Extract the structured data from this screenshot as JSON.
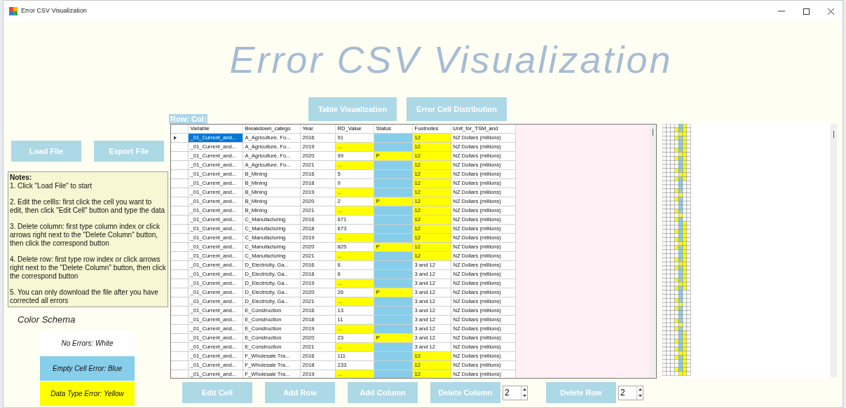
{
  "window": {
    "title": "Error CSV Visualization"
  },
  "heading": "Error CSV Visualization",
  "view_buttons": [
    "Table Visualization",
    "Error Cell Distribution"
  ],
  "position_label": "Row: Col:",
  "file_buttons": [
    "Load File",
    "Export File"
  ],
  "notes": {
    "title": "Notes:",
    "items": [
      "1. Click \"Load File\" to start",
      "2. Edit the cellls: first click the cell you want to edit, then click \"Edit Cell\" button and type the data",
      "3. Delete column: first type column index or click arrows right next to the \"Delete Column\" button,  then click the correspond button",
      "4. Delete row: first type row index or click arrows right next to the \"Delete Column\" button, then click the correspond button",
      "5. You can only download the file after you have corrected all errors"
    ]
  },
  "color_schema": {
    "title": "Color Schema",
    "entries": [
      {
        "label": "No Errors: White",
        "color": "#ffffff"
      },
      {
        "label": "Empty Cell Error: Blue",
        "color": "#87ceeb"
      },
      {
        "label": "Data Type Error: Yellow",
        "color": "#ffff00"
      }
    ]
  },
  "table": {
    "columns": [
      "Variable",
      "Breakdown_catego",
      "Year",
      "RD_Value",
      "Status",
      "Footnotes",
      "Unit_for_TSM_and"
    ],
    "rows": [
      {
        "current": true,
        "cells": [
          {
            "text": "_01_Current_and...",
            "empty_error": false,
            "type_error": false,
            "selected": true
          },
          {
            "text": "A_Agriculture, Fo...",
            "empty_error": false,
            "type_error": false,
            "selected": false
          },
          {
            "text": "2016",
            "empty_error": false,
            "type_error": false,
            "selected": false
          },
          {
            "text": "91",
            "empty_error": false,
            "type_error": false,
            "selected": false
          },
          {
            "empty_error": true,
            "type_error": false,
            "selected": false
          },
          {
            "text": "12",
            "empty_error": false,
            "type_error": true,
            "selected": false
          },
          {
            "text": "NZ Dollars (millions)",
            "empty_error": false,
            "type_error": false,
            "selected": false
          }
        ]
      },
      {
        "current": false,
        "cells": [
          {
            "text": "_01_Current_and...",
            "empty_error": false,
            "type_error": false,
            "selected": false
          },
          {
            "text": "A_Agriculture, Fo...",
            "empty_error": false,
            "type_error": false,
            "selected": false
          },
          {
            "text": "2019",
            "empty_error": false,
            "type_error": false,
            "selected": false
          },
          {
            "text": "...",
            "empty_error": false,
            "type_error": true,
            "selected": false
          },
          {
            "empty_error": true,
            "type_error": false,
            "selected": false
          },
          {
            "text": "12",
            "empty_error": false,
            "type_error": true,
            "selected": false
          },
          {
            "text": "NZ Dollars (millions)",
            "empty_error": false,
            "type_error": false,
            "selected": false
          }
        ]
      },
      {
        "current": false,
        "cells": [
          {
            "text": "_01_Current_and...",
            "empty_error": false,
            "type_error": false,
            "selected": false
          },
          {
            "text": "A_Agriculture, Fo...",
            "empty_error": false,
            "type_error": false,
            "selected": false
          },
          {
            "text": "2020",
            "empty_error": false,
            "type_error": false,
            "selected": false
          },
          {
            "text": "99",
            "empty_error": false,
            "type_error": false,
            "selected": false
          },
          {
            "text": "P",
            "empty_error": false,
            "type_error": true,
            "selected": false
          },
          {
            "text": "12",
            "empty_error": false,
            "type_error": true,
            "selected": false
          },
          {
            "text": "NZ Dollars (millions)",
            "empty_error": false,
            "type_error": false,
            "selected": false
          }
        ]
      },
      {
        "current": false,
        "cells": [
          {
            "text": "_01_Current_and...",
            "empty_error": false,
            "type_error": false,
            "selected": false
          },
          {
            "text": "A_Agriculture, Fo...",
            "empty_error": false,
            "type_error": false,
            "selected": false
          },
          {
            "text": "2021",
            "empty_error": false,
            "type_error": false,
            "selected": false
          },
          {
            "text": "...",
            "empty_error": false,
            "type_error": true,
            "selected": false
          },
          {
            "empty_error": true,
            "type_error": false,
            "selected": false
          },
          {
            "text": "12",
            "empty_error": false,
            "type_error": true,
            "selected": false
          },
          {
            "text": "NZ Dollars (millions)",
            "empty_error": false,
            "type_error": false,
            "selected": false
          }
        ]
      },
      {
        "current": false,
        "cells": [
          {
            "text": "_01_Current_and...",
            "empty_error": false,
            "type_error": false,
            "selected": false
          },
          {
            "text": "B_Mining",
            "empty_error": false,
            "type_error": false,
            "selected": false
          },
          {
            "text": "2016",
            "empty_error": false,
            "type_error": false,
            "selected": false
          },
          {
            "text": "5",
            "empty_error": false,
            "type_error": false,
            "selected": false
          },
          {
            "empty_error": true,
            "type_error": false,
            "selected": false
          },
          {
            "text": "12",
            "empty_error": false,
            "type_error": true,
            "selected": false
          },
          {
            "text": "NZ Dollars (millions)",
            "empty_error": false,
            "type_error": false,
            "selected": false
          }
        ]
      },
      {
        "current": false,
        "cells": [
          {
            "text": "_01_Current_and...",
            "empty_error": false,
            "type_error": false,
            "selected": false
          },
          {
            "text": "B_Mining",
            "empty_error": false,
            "type_error": false,
            "selected": false
          },
          {
            "text": "2018",
            "empty_error": false,
            "type_error": false,
            "selected": false
          },
          {
            "text": "9",
            "empty_error": false,
            "type_error": false,
            "selected": false
          },
          {
            "empty_error": true,
            "type_error": false,
            "selected": false
          },
          {
            "text": "12",
            "empty_error": false,
            "type_error": true,
            "selected": false
          },
          {
            "text": "NZ Dollars (millions)",
            "empty_error": false,
            "type_error": false,
            "selected": false
          }
        ]
      },
      {
        "current": false,
        "cells": [
          {
            "text": "_01_Current_and...",
            "empty_error": false,
            "type_error": false,
            "selected": false
          },
          {
            "text": "B_Mining",
            "empty_error": false,
            "type_error": false,
            "selected": false
          },
          {
            "text": "2019",
            "empty_error": false,
            "type_error": false,
            "selected": false
          },
          {
            "text": "...",
            "empty_error": false,
            "type_error": true,
            "selected": false
          },
          {
            "empty_error": true,
            "type_error": false,
            "selected": false
          },
          {
            "text": "12",
            "empty_error": false,
            "type_error": true,
            "selected": false
          },
          {
            "text": "NZ Dollars (millions)",
            "empty_error": false,
            "type_error": false,
            "selected": false
          }
        ]
      },
      {
        "current": false,
        "cells": [
          {
            "text": "_01_Current_and...",
            "empty_error": false,
            "type_error": false,
            "selected": false
          },
          {
            "text": "B_Mining",
            "empty_error": false,
            "type_error": false,
            "selected": false
          },
          {
            "text": "2020",
            "empty_error": false,
            "type_error": false,
            "selected": false
          },
          {
            "text": "2",
            "empty_error": false,
            "type_error": false,
            "selected": false
          },
          {
            "text": "P",
            "empty_error": false,
            "type_error": true,
            "selected": false
          },
          {
            "text": "12",
            "empty_error": false,
            "type_error": true,
            "selected": false
          },
          {
            "text": "NZ Dollars (millions)",
            "empty_error": false,
            "type_error": false,
            "selected": false
          }
        ]
      },
      {
        "current": false,
        "cells": [
          {
            "text": "_01_Current_and...",
            "empty_error": false,
            "type_error": false,
            "selected": false
          },
          {
            "text": "B_Mining",
            "empty_error": false,
            "type_error": false,
            "selected": false
          },
          {
            "text": "2021",
            "empty_error": false,
            "type_error": false,
            "selected": false
          },
          {
            "text": "...",
            "empty_error": false,
            "type_error": true,
            "selected": false
          },
          {
            "empty_error": true,
            "type_error": false,
            "selected": false
          },
          {
            "text": "12",
            "empty_error": false,
            "type_error": true,
            "selected": false
          },
          {
            "text": "NZ Dollars (millions)",
            "empty_error": false,
            "type_error": false,
            "selected": false
          }
        ]
      },
      {
        "current": false,
        "cells": [
          {
            "text": "_01_Current_and...",
            "empty_error": false,
            "type_error": false,
            "selected": false
          },
          {
            "text": "C_Manufacturing",
            "empty_error": false,
            "type_error": false,
            "selected": false
          },
          {
            "text": "2016",
            "empty_error": false,
            "type_error": false,
            "selected": false
          },
          {
            "text": "671",
            "empty_error": false,
            "type_error": false,
            "selected": false
          },
          {
            "empty_error": true,
            "type_error": false,
            "selected": false
          },
          {
            "text": "12",
            "empty_error": false,
            "type_error": true,
            "selected": false
          },
          {
            "text": "NZ Dollars (millions)",
            "empty_error": false,
            "type_error": false,
            "selected": false
          }
        ]
      },
      {
        "current": false,
        "cells": [
          {
            "text": "_01_Current_and...",
            "empty_error": false,
            "type_error": false,
            "selected": false
          },
          {
            "text": "C_Manufacturing",
            "empty_error": false,
            "type_error": false,
            "selected": false
          },
          {
            "text": "2018",
            "empty_error": false,
            "type_error": false,
            "selected": false
          },
          {
            "text": "673",
            "empty_error": false,
            "type_error": false,
            "selected": false
          },
          {
            "empty_error": true,
            "type_error": false,
            "selected": false
          },
          {
            "text": "12",
            "empty_error": false,
            "type_error": true,
            "selected": false
          },
          {
            "text": "NZ Dollars (millions)",
            "empty_error": false,
            "type_error": false,
            "selected": false
          }
        ]
      },
      {
        "current": false,
        "cells": [
          {
            "text": "_01_Current_and...",
            "empty_error": false,
            "type_error": false,
            "selected": false
          },
          {
            "text": "C_Manufacturing",
            "empty_error": false,
            "type_error": false,
            "selected": false
          },
          {
            "text": "2019",
            "empty_error": false,
            "type_error": false,
            "selected": false
          },
          {
            "text": "...",
            "empty_error": false,
            "type_error": true,
            "selected": false
          },
          {
            "empty_error": true,
            "type_error": false,
            "selected": false
          },
          {
            "text": "12",
            "empty_error": false,
            "type_error": true,
            "selected": false
          },
          {
            "text": "NZ Dollars (millions)",
            "empty_error": false,
            "type_error": false,
            "selected": false
          }
        ]
      },
      {
        "current": false,
        "cells": [
          {
            "text": "_01_Current_and...",
            "empty_error": false,
            "type_error": false,
            "selected": false
          },
          {
            "text": "C_Manufacturing",
            "empty_error": false,
            "type_error": false,
            "selected": false
          },
          {
            "text": "2020",
            "empty_error": false,
            "type_error": false,
            "selected": false
          },
          {
            "text": "825",
            "empty_error": false,
            "type_error": false,
            "selected": false
          },
          {
            "text": "P",
            "empty_error": false,
            "type_error": true,
            "selected": false
          },
          {
            "text": "12",
            "empty_error": false,
            "type_error": true,
            "selected": false
          },
          {
            "text": "NZ Dollars (millions)",
            "empty_error": false,
            "type_error": false,
            "selected": false
          }
        ]
      },
      {
        "current": false,
        "cells": [
          {
            "text": "_01_Current_and...",
            "empty_error": false,
            "type_error": false,
            "selected": false
          },
          {
            "text": "C_Manufacturing",
            "empty_error": false,
            "type_error": false,
            "selected": false
          },
          {
            "text": "2021",
            "empty_error": false,
            "type_error": false,
            "selected": false
          },
          {
            "text": "...",
            "empty_error": false,
            "type_error": true,
            "selected": false
          },
          {
            "empty_error": true,
            "type_error": false,
            "selected": false
          },
          {
            "text": "12",
            "empty_error": false,
            "type_error": true,
            "selected": false
          },
          {
            "text": "NZ Dollars (millions)",
            "empty_error": false,
            "type_error": false,
            "selected": false
          }
        ]
      },
      {
        "current": false,
        "cells": [
          {
            "text": "_01_Current_and...",
            "empty_error": false,
            "type_error": false,
            "selected": false
          },
          {
            "text": "D_Electricity, Ga...",
            "empty_error": false,
            "type_error": false,
            "selected": false
          },
          {
            "text": "2016",
            "empty_error": false,
            "type_error": false,
            "selected": false
          },
          {
            "text": "6",
            "empty_error": false,
            "type_error": false,
            "selected": false
          },
          {
            "empty_error": true,
            "type_error": false,
            "selected": false
          },
          {
            "text": "3 and 12",
            "empty_error": false,
            "type_error": false,
            "selected": false
          },
          {
            "text": "NZ Dollars (millions)",
            "empty_error": false,
            "type_error": false,
            "selected": false
          }
        ]
      },
      {
        "current": false,
        "cells": [
          {
            "text": "_01_Current_and...",
            "empty_error": false,
            "type_error": false,
            "selected": false
          },
          {
            "text": "D_Electricity, Ga...",
            "empty_error": false,
            "type_error": false,
            "selected": false
          },
          {
            "text": "2018",
            "empty_error": false,
            "type_error": false,
            "selected": false
          },
          {
            "text": "6",
            "empty_error": false,
            "type_error": false,
            "selected": false
          },
          {
            "empty_error": true,
            "type_error": false,
            "selected": false
          },
          {
            "text": "3 and 12",
            "empty_error": false,
            "type_error": false,
            "selected": false
          },
          {
            "text": "NZ Dollars (millions)",
            "empty_error": false,
            "type_error": false,
            "selected": false
          }
        ]
      },
      {
        "current": false,
        "cells": [
          {
            "text": "_01_Current_and...",
            "empty_error": false,
            "type_error": false,
            "selected": false
          },
          {
            "text": "D_Electricity, Ga...",
            "empty_error": false,
            "type_error": false,
            "selected": false
          },
          {
            "text": "2019",
            "empty_error": false,
            "type_error": false,
            "selected": false
          },
          {
            "text": "...",
            "empty_error": false,
            "type_error": true,
            "selected": false
          },
          {
            "empty_error": true,
            "type_error": false,
            "selected": false
          },
          {
            "text": "3 and 12",
            "empty_error": false,
            "type_error": false,
            "selected": false
          },
          {
            "text": "NZ Dollars (millions)",
            "empty_error": false,
            "type_error": false,
            "selected": false
          }
        ]
      },
      {
        "current": false,
        "cells": [
          {
            "text": "_01_Current_and...",
            "empty_error": false,
            "type_error": false,
            "selected": false
          },
          {
            "text": "D_Electricity, Ga...",
            "empty_error": false,
            "type_error": false,
            "selected": false
          },
          {
            "text": "2020",
            "empty_error": false,
            "type_error": false,
            "selected": false
          },
          {
            "text": "26",
            "empty_error": false,
            "type_error": false,
            "selected": false
          },
          {
            "text": "P",
            "empty_error": false,
            "type_error": true,
            "selected": false
          },
          {
            "text": "3 and 12",
            "empty_error": false,
            "type_error": false,
            "selected": false
          },
          {
            "text": "NZ Dollars (millions)",
            "empty_error": false,
            "type_error": false,
            "selected": false
          }
        ]
      },
      {
        "current": false,
        "cells": [
          {
            "text": "_01_Current_and...",
            "empty_error": false,
            "type_error": false,
            "selected": false
          },
          {
            "text": "D_Electricity, Ga...",
            "empty_error": false,
            "type_error": false,
            "selected": false
          },
          {
            "text": "2021",
            "empty_error": false,
            "type_error": false,
            "selected": false
          },
          {
            "text": "...",
            "empty_error": false,
            "type_error": true,
            "selected": false
          },
          {
            "empty_error": true,
            "type_error": false,
            "selected": false
          },
          {
            "text": "3 and 12",
            "empty_error": false,
            "type_error": false,
            "selected": false
          },
          {
            "text": "NZ Dollars (millions)",
            "empty_error": false,
            "type_error": false,
            "selected": false
          }
        ]
      },
      {
        "current": false,
        "cells": [
          {
            "text": "_01_Current_and...",
            "empty_error": false,
            "type_error": false,
            "selected": false
          },
          {
            "text": "E_Construction",
            "empty_error": false,
            "type_error": false,
            "selected": false
          },
          {
            "text": "2016",
            "empty_error": false,
            "type_error": false,
            "selected": false
          },
          {
            "text": "13",
            "empty_error": false,
            "type_error": false,
            "selected": false
          },
          {
            "empty_error": true,
            "type_error": false,
            "selected": false
          },
          {
            "text": "3 and 12",
            "empty_error": false,
            "type_error": false,
            "selected": false
          },
          {
            "text": "NZ Dollars (millions)",
            "empty_error": false,
            "type_error": false,
            "selected": false
          }
        ]
      },
      {
        "current": false,
        "cells": [
          {
            "text": "_01_Current_and...",
            "empty_error": false,
            "type_error": false,
            "selected": false
          },
          {
            "text": "E_Construction",
            "empty_error": false,
            "type_error": false,
            "selected": false
          },
          {
            "text": "2018",
            "empty_error": false,
            "type_error": false,
            "selected": false
          },
          {
            "text": "11",
            "empty_error": false,
            "type_error": false,
            "selected": false
          },
          {
            "empty_error": true,
            "type_error": false,
            "selected": false
          },
          {
            "text": "3 and 12",
            "empty_error": false,
            "type_error": false,
            "selected": false
          },
          {
            "text": "NZ Dollars (millions)",
            "empty_error": false,
            "type_error": false,
            "selected": false
          }
        ]
      },
      {
        "current": false,
        "cells": [
          {
            "text": "_01_Current_and...",
            "empty_error": false,
            "type_error": false,
            "selected": false
          },
          {
            "text": "E_Construction",
            "empty_error": false,
            "type_error": false,
            "selected": false
          },
          {
            "text": "2019",
            "empty_error": false,
            "type_error": false,
            "selected": false
          },
          {
            "text": "...",
            "empty_error": false,
            "type_error": true,
            "selected": false
          },
          {
            "empty_error": true,
            "type_error": false,
            "selected": false
          },
          {
            "text": "3 and 12",
            "empty_error": false,
            "type_error": false,
            "selected": false
          },
          {
            "text": "NZ Dollars (millions)",
            "empty_error": false,
            "type_error": false,
            "selected": false
          }
        ]
      },
      {
        "current": false,
        "cells": [
          {
            "text": "_01_Current_and...",
            "empty_error": false,
            "type_error": false,
            "selected": false
          },
          {
            "text": "E_Construction",
            "empty_error": false,
            "type_error": false,
            "selected": false
          },
          {
            "text": "2020",
            "empty_error": false,
            "type_error": false,
            "selected": false
          },
          {
            "text": "23",
            "empty_error": false,
            "type_error": false,
            "selected": false
          },
          {
            "text": "P",
            "empty_error": false,
            "type_error": true,
            "selected": false
          },
          {
            "text": "3 and 12",
            "empty_error": false,
            "type_error": false,
            "selected": false
          },
          {
            "text": "NZ Dollars (millions)",
            "empty_error": false,
            "type_error": false,
            "selected": false
          }
        ]
      },
      {
        "current": false,
        "cells": [
          {
            "text": "_01_Current_and...",
            "empty_error": false,
            "type_error": false,
            "selected": false
          },
          {
            "text": "E_Construction",
            "empty_error": false,
            "type_error": false,
            "selected": false
          },
          {
            "text": "2021",
            "empty_error": false,
            "type_error": false,
            "selected": false
          },
          {
            "text": "...",
            "empty_error": false,
            "type_error": true,
            "selected": false
          },
          {
            "empty_error": true,
            "type_error": false,
            "selected": false
          },
          {
            "text": "3 and 12",
            "empty_error": false,
            "type_error": false,
            "selected": false
          },
          {
            "text": "NZ Dollars (millions)",
            "empty_error": false,
            "type_error": false,
            "selected": false
          }
        ]
      },
      {
        "current": false,
        "cells": [
          {
            "text": "_01_Current_and...",
            "empty_error": false,
            "type_error": false,
            "selected": false
          },
          {
            "text": "F_Wholesale Tra...",
            "empty_error": false,
            "type_error": false,
            "selected": false
          },
          {
            "text": "2016",
            "empty_error": false,
            "type_error": false,
            "selected": false
          },
          {
            "text": "111",
            "empty_error": false,
            "type_error": false,
            "selected": false
          },
          {
            "empty_error": true,
            "type_error": false,
            "selected": false
          },
          {
            "text": "12",
            "empty_error": false,
            "type_error": true,
            "selected": false
          },
          {
            "text": "NZ Dollars (millions)",
            "empty_error": false,
            "type_error": false,
            "selected": false
          }
        ]
      },
      {
        "current": false,
        "cells": [
          {
            "text": "_01_Current_and...",
            "empty_error": false,
            "type_error": false,
            "selected": false
          },
          {
            "text": "F_Wholesale Tra...",
            "empty_error": false,
            "type_error": false,
            "selected": false
          },
          {
            "text": "2018",
            "empty_error": false,
            "type_error": false,
            "selected": false
          },
          {
            "text": "233",
            "empty_error": false,
            "type_error": false,
            "selected": false
          },
          {
            "empty_error": true,
            "type_error": false,
            "selected": false
          },
          {
            "text": "12",
            "empty_error": false,
            "type_error": true,
            "selected": false
          },
          {
            "text": "NZ Dollars (millions)",
            "empty_error": false,
            "type_error": false,
            "selected": false
          }
        ]
      },
      {
        "current": false,
        "cells": [
          {
            "text": "_01_Current_and...",
            "empty_error": false,
            "type_error": false,
            "selected": false
          },
          {
            "text": "F_Wholesale Tra...",
            "empty_error": false,
            "type_error": false,
            "selected": false
          },
          {
            "text": "2019",
            "empty_error": false,
            "type_error": false,
            "selected": false
          },
          {
            "text": "...",
            "empty_error": false,
            "type_error": true,
            "selected": false
          },
          {
            "empty_error": true,
            "type_error": false,
            "selected": false
          },
          {
            "text": "12",
            "empty_error": false,
            "type_error": true,
            "selected": false
          },
          {
            "text": "NZ Dollars (millions)",
            "empty_error": false,
            "type_error": false,
            "selected": false
          }
        ]
      }
    ]
  },
  "actions": [
    {
      "kind": "button",
      "label": "Edit Cell"
    },
    {
      "kind": "button",
      "label": "Add Row"
    },
    {
      "kind": "button",
      "label": "Add Column"
    },
    {
      "kind": "button",
      "label": "Delete Column"
    },
    {
      "kind": "spinner",
      "value": "2"
    },
    {
      "kind": "button",
      "label": "Delete Row"
    },
    {
      "kind": "spinner",
      "value": "2"
    }
  ]
}
